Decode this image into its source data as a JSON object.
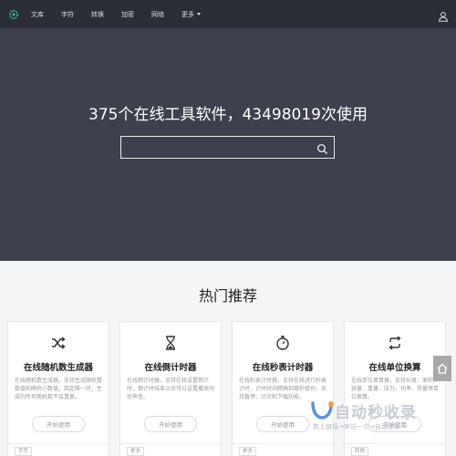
{
  "nav": {
    "items": [
      "文库",
      "字符",
      "转换",
      "加密",
      "网络"
    ],
    "more_label": "更多"
  },
  "hero": {
    "title": "375个在线工具软件，43498019次使用",
    "search_placeholder": ""
  },
  "section": {
    "title": "热门推荐"
  },
  "cards": [
    {
      "icon": "shuffle-icon",
      "title": "在线随机数生成器",
      "desc": "在线随机数生成器，支持生成随机整数值和随机小数值，指定唯一时，生成的所有随机数不会重复。",
      "button": "开始使用",
      "tag": "字符"
    },
    {
      "icon": "hourglass-icon",
      "title": "在线倒计时器",
      "desc": "在线倒计时器，支持在线设置倒计时，倒计时结束以后可以设置播放闹铃声音。",
      "button": "开始使用",
      "tag": "更多"
    },
    {
      "icon": "stopwatch-icon",
      "title": "在线秒表计时器",
      "desc": "在线秒表计时器，支持在线进行秒表计时，计时时间精确到毫秒级别，支持暂停、计次和下载功能。",
      "button": "开始使用",
      "tag": "更多"
    },
    {
      "icon": "convert-icon",
      "title": "在线单位换算",
      "desc": "在线单位换算器，支持长度、面积、容量、重量、压力、功率、热量等单位换算。",
      "button": "开始使用",
      "tag": "转换"
    }
  ],
  "watermark": {
    "main": "自动秒收录",
    "sub": "数上链接→来访一次→自动收录→"
  },
  "colors": {
    "navbar": "#2b2e37",
    "hero": "#3d414d",
    "page": "#f4f5f7",
    "logo_green": "#2eb88a"
  }
}
